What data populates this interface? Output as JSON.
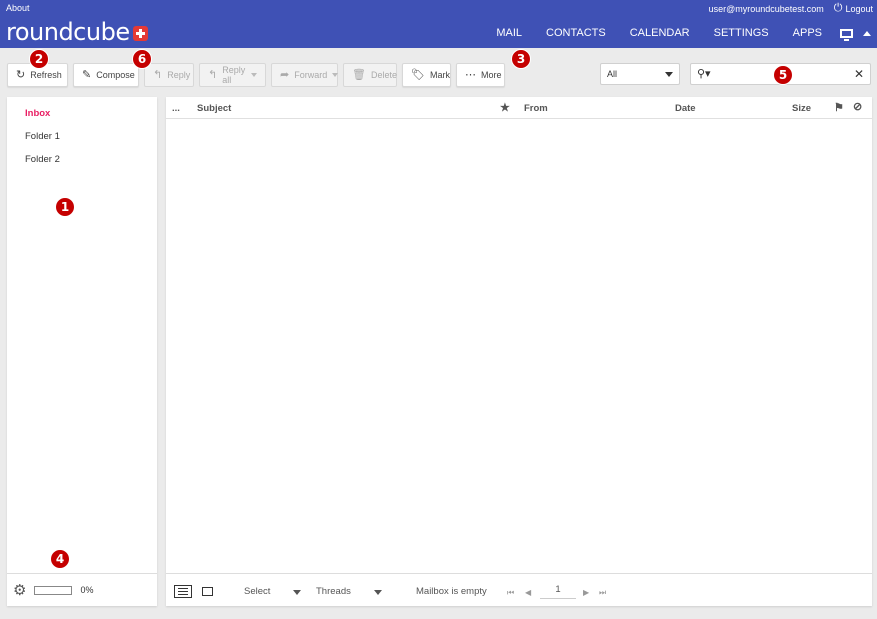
{
  "header": {
    "about": "About",
    "user": "user@myroundcubetest.com",
    "logout": "Logout",
    "logo": "roundcube",
    "nav": [
      "MAIL",
      "CONTACTS",
      "CALENDAR",
      "SETTINGS",
      "APPS"
    ],
    "brand_color": "#3f51b5"
  },
  "toolbar": {
    "refresh": "Refresh",
    "compose": "Compose",
    "reply": "Reply",
    "reply_all": "Reply all",
    "forward": "Forward",
    "delete": "Delete",
    "mark": "Mark",
    "more": "More"
  },
  "filter": {
    "selected": "All"
  },
  "search": {
    "placeholder": ""
  },
  "folders": [
    "Inbox",
    "Folder 1",
    "Folder 2"
  ],
  "quota": {
    "value": "0%"
  },
  "list": {
    "columns": {
      "threads": "...",
      "subject": "Subject",
      "from": "From",
      "date": "Date",
      "size": "Size"
    }
  },
  "footer": {
    "select": "Select",
    "threads": "Threads",
    "status": "Mailbox is empty",
    "page": "1"
  },
  "callouts": [
    "1",
    "2",
    "3",
    "4",
    "5",
    "6"
  ],
  "accent_color": "#e91e63",
  "callout_color": "#c50000"
}
